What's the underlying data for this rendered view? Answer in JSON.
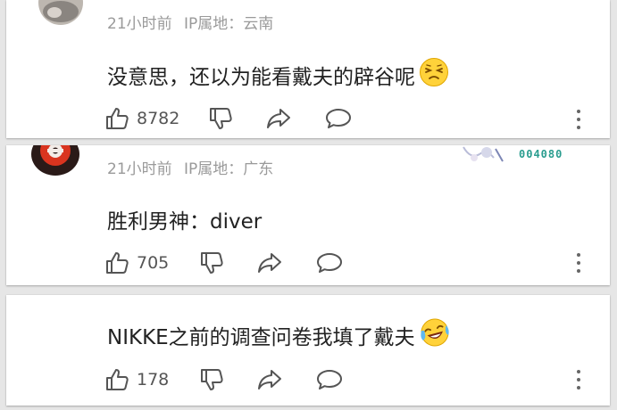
{
  "comments": [
    {
      "time": "21小时前",
      "location": "IP属地：云南",
      "text": "没意思，还以为能看戴夫的辟谷呢",
      "emoji": "smirk-face-icon",
      "likes": "8782"
    },
    {
      "time": "21小时前",
      "location": "IP属地：广东",
      "text": "胜利男神：diver",
      "badge": "004080",
      "likes": "705"
    },
    {
      "text": "NIKKE之前的调查问卷我填了戴夫",
      "emoji": "laughing-tears-face-icon",
      "likes": "178"
    }
  ],
  "colors": {
    "meta": "#9a9a9a",
    "text": "#222222",
    "icon": "#555555",
    "badge": "#2a9d8f"
  }
}
